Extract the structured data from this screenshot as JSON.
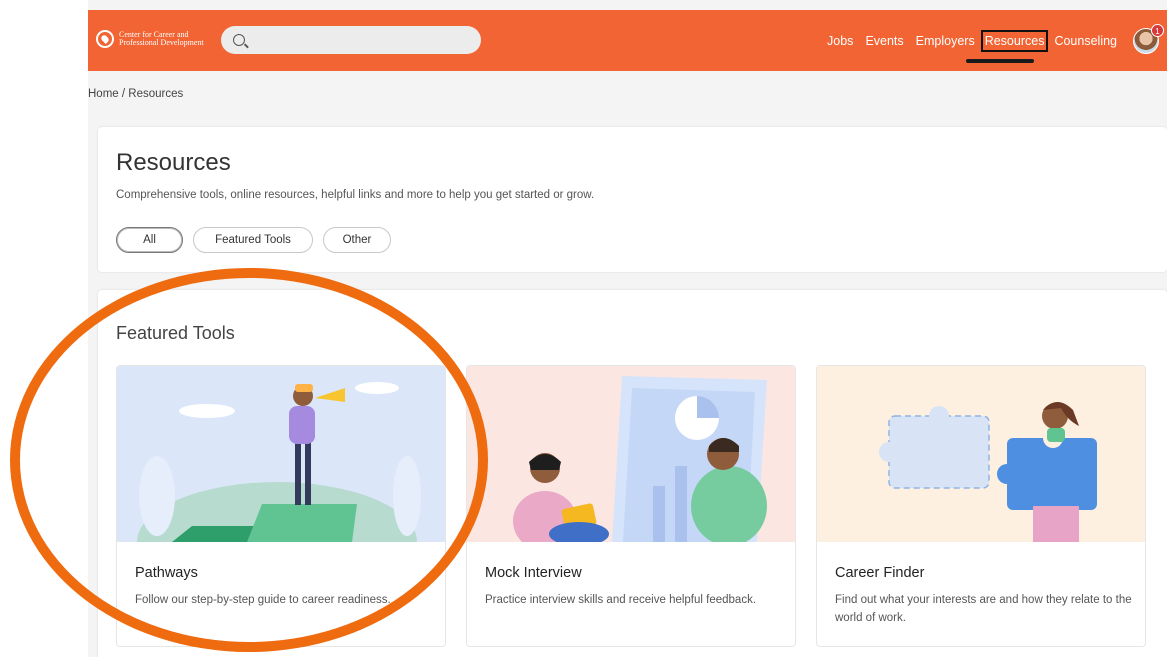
{
  "brand": {
    "line1": "Center for Career and",
    "line2": "Professional Development"
  },
  "search": {
    "placeholder": ""
  },
  "nav": {
    "items": [
      "Jobs",
      "Events",
      "Employers",
      "Resources",
      "Counseling"
    ],
    "active": "Resources"
  },
  "avatar": {
    "badge": "1"
  },
  "breadcrumb": {
    "home": "Home",
    "separator": "/",
    "current": "Resources"
  },
  "header": {
    "title": "Resources",
    "subtitle": "Comprehensive tools, online resources, helpful links and more to help you get started or grow.",
    "filters": [
      "All",
      "Featured Tools",
      "Other"
    ],
    "selected_filter": "All"
  },
  "featured": {
    "heading": "Featured Tools",
    "tools": [
      {
        "title": "Pathways",
        "description": "Follow our step-by-step guide to career readiness.",
        "icon": "person-with-telescope-illustration",
        "bg": "#dbe7f9"
      },
      {
        "title": "Mock Interview",
        "description": "Practice interview skills and receive helpful feedback.",
        "icon": "interview-illustration",
        "bg": "#fbe6e2"
      },
      {
        "title": "Career Finder",
        "description": "Find out what your interests are and how they relate to the world of work.",
        "icon": "puzzle-illustration",
        "bg": "#fdf0e0"
      }
    ]
  },
  "colors": {
    "brand": "#f26433",
    "annotation": "#ef6b0f"
  }
}
